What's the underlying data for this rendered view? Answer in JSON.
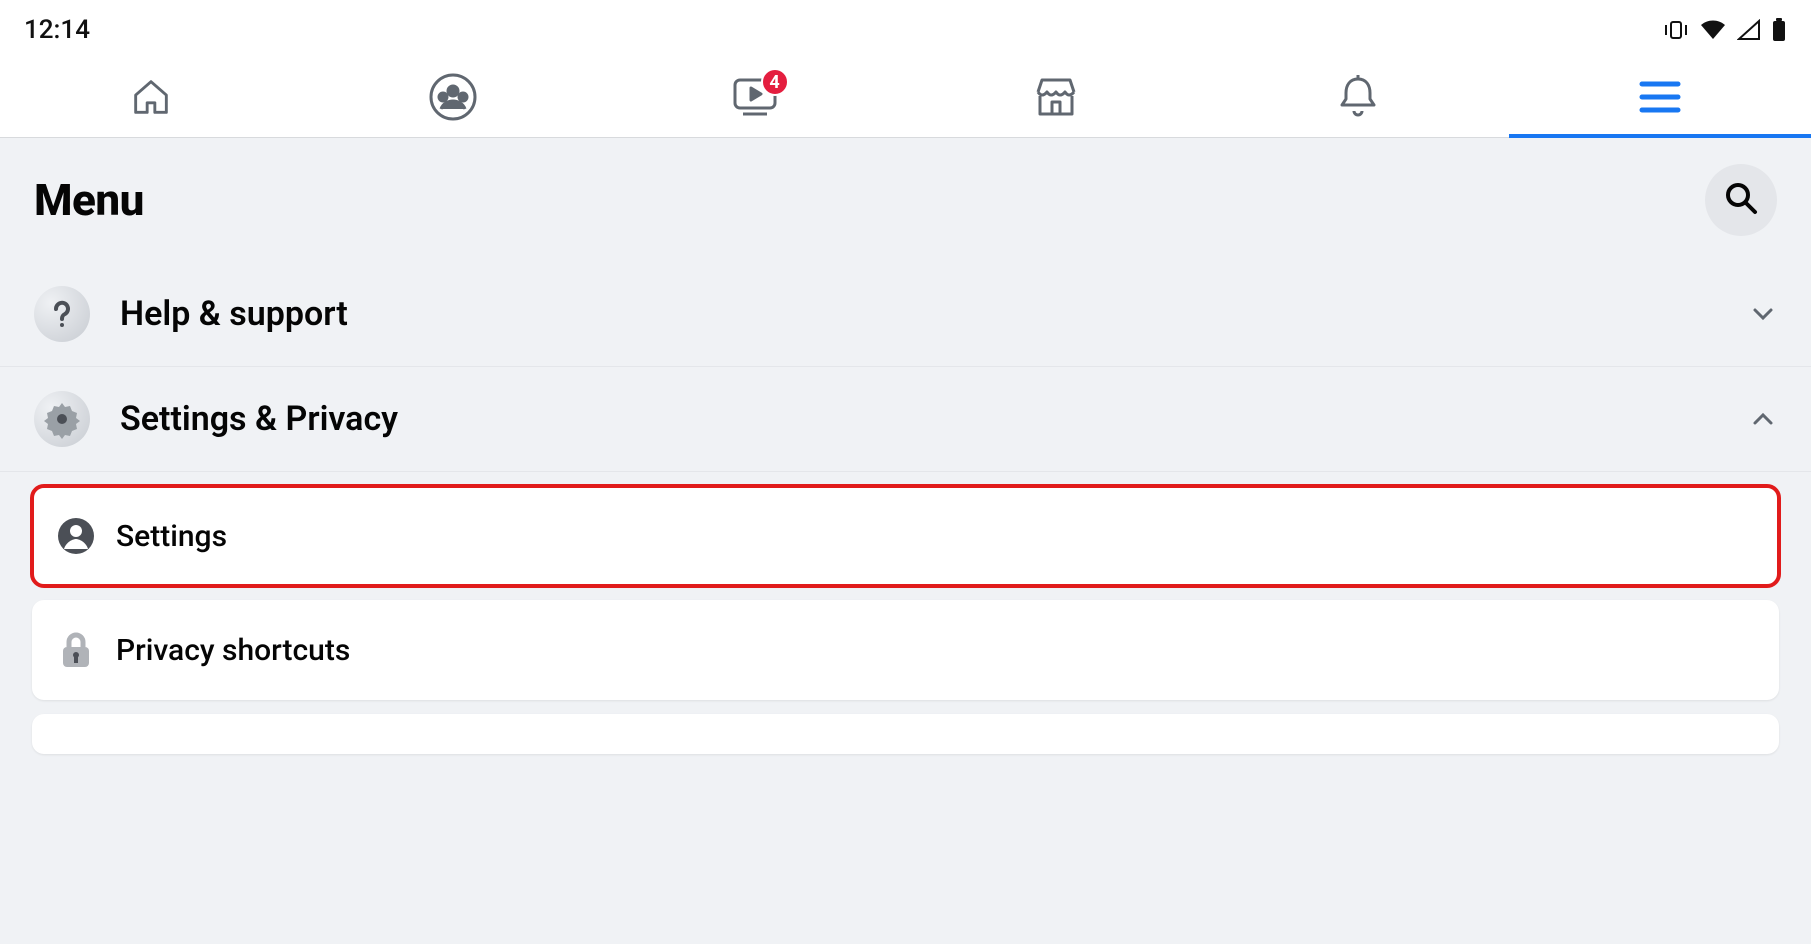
{
  "status_bar": {
    "time": "12:14"
  },
  "nav": {
    "tabs": [
      {
        "name": "home",
        "icon": "home-icon"
      },
      {
        "name": "groups",
        "icon": "groups-icon"
      },
      {
        "name": "watch",
        "icon": "watch-icon",
        "badge": "4"
      },
      {
        "name": "marketplace",
        "icon": "marketplace-icon"
      },
      {
        "name": "notifications",
        "icon": "bell-icon"
      },
      {
        "name": "menu",
        "icon": "hamburger-icon",
        "active": true
      }
    ]
  },
  "page": {
    "title": "Menu",
    "sections": [
      {
        "id": "help",
        "label": "Help & support",
        "icon": "question-icon",
        "expanded": false
      },
      {
        "id": "settings_privacy",
        "label": "Settings & Privacy",
        "icon": "gear-icon",
        "expanded": true,
        "items": [
          {
            "id": "settings",
            "label": "Settings",
            "icon": "person-icon",
            "highlighted": true
          },
          {
            "id": "privacy_shortcuts",
            "label": "Privacy shortcuts",
            "icon": "lock-icon",
            "highlighted": false
          }
        ]
      }
    ]
  },
  "colors": {
    "accent": "#1877f2",
    "badge": "#e41e3f",
    "surface": "#f0f2f5",
    "highlight": "#e11b1b"
  }
}
